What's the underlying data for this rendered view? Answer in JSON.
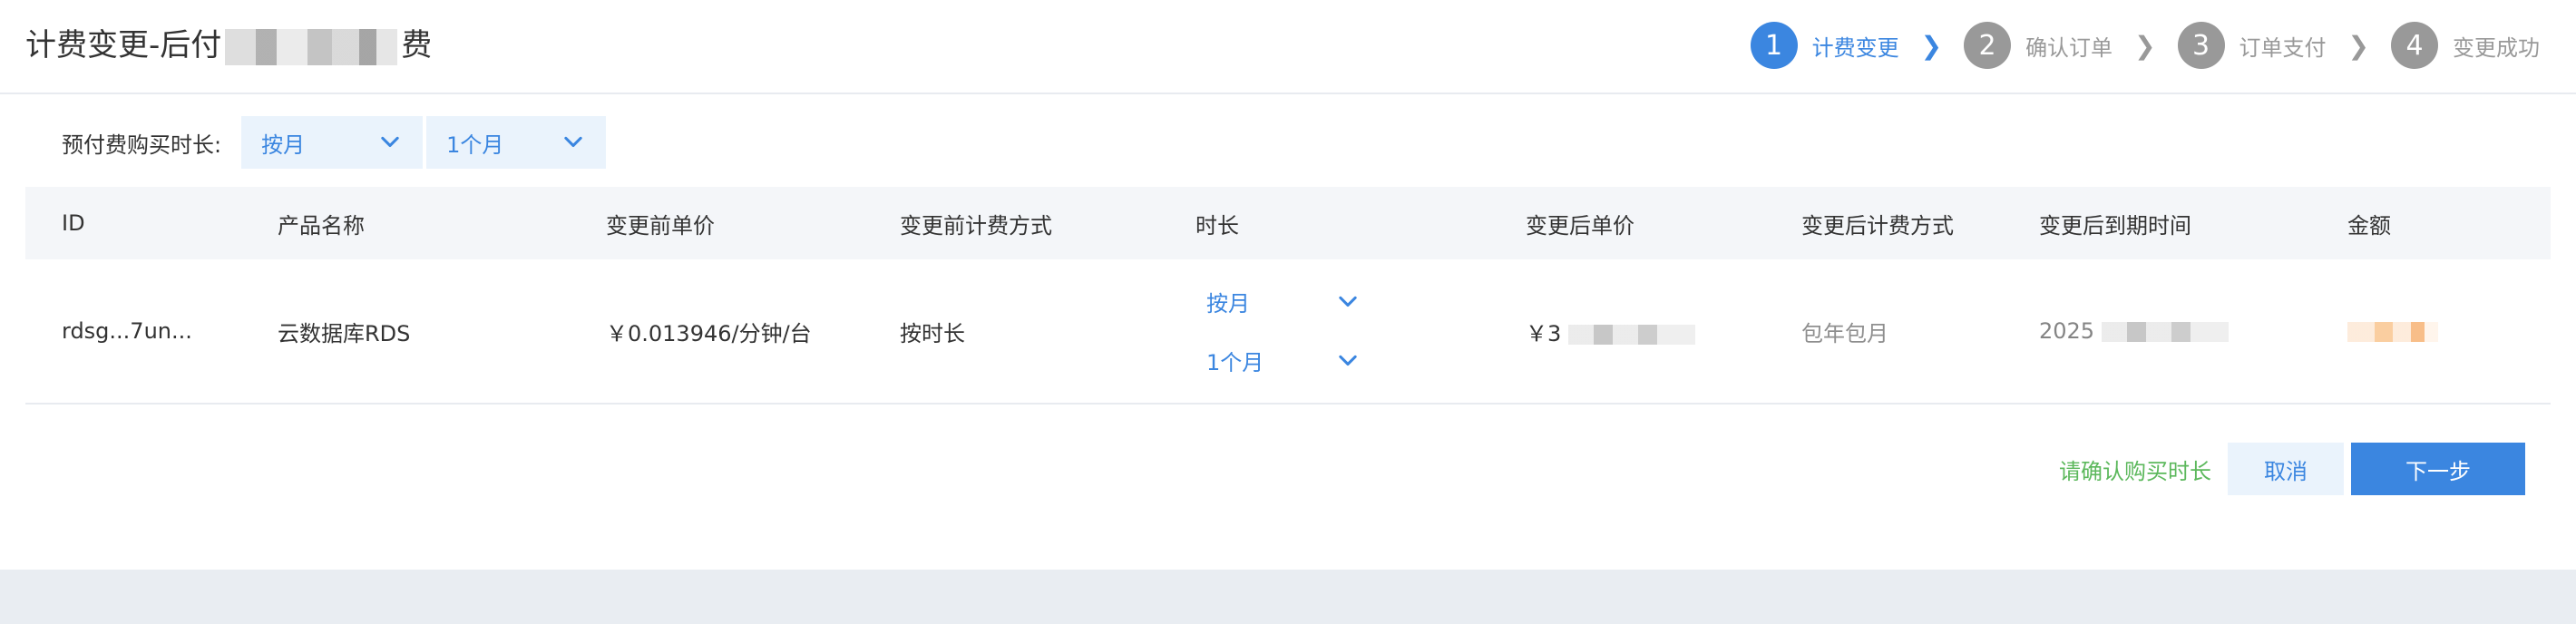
{
  "header": {
    "title_prefix": "计费变更-后付",
    "title_suffix": "费"
  },
  "steps": [
    {
      "number": "1",
      "label": "计费变更",
      "active": true
    },
    {
      "number": "2",
      "label": "确认订单",
      "active": false
    },
    {
      "number": "3",
      "label": "订单支付",
      "active": false
    },
    {
      "number": "4",
      "label": "变更成功",
      "active": false
    }
  ],
  "prepay": {
    "label": "预付费购买时长:",
    "unit_select": "按月",
    "duration_select": "1个月"
  },
  "table": {
    "headers": [
      "ID",
      "产品名称",
      "变更前单价",
      "变更前计费方式",
      "时长",
      "变更后单价",
      "变更后计费方式",
      "变更后到期时间",
      "金额"
    ],
    "row": {
      "id": "rdsg...7un...",
      "product": "云数据库RDS",
      "price_before": "￥0.013946/分钟/台",
      "billing_before": "按时长",
      "duration_unit": "按月",
      "duration_value": "1个月",
      "price_after": "￥3",
      "billing_after": "包年包月",
      "expire_after": "2025",
      "amount": ""
    }
  },
  "footer": {
    "hint": "请确认购买时长",
    "cancel_label": "取消",
    "next_label": "下一步"
  },
  "colors": {
    "accent": "#3b86e0",
    "hint_green": "#5cb85c"
  }
}
